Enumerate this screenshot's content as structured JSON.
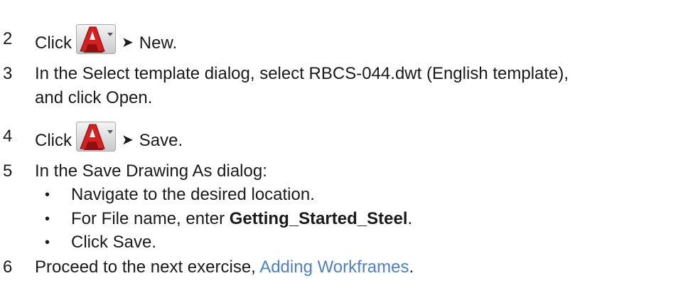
{
  "steps": [
    {
      "num": "2",
      "pre": "Click",
      "arrow": "➤",
      "post": "New."
    },
    {
      "num": "3",
      "line1": "In the Select template dialog, select RBCS-044.dwt (English template),",
      "line2": "and click Open."
    },
    {
      "num": "4",
      "pre": "Click",
      "arrow": "➤",
      "post": "Save."
    },
    {
      "num": "5",
      "text": "In the Save Drawing As dialog:"
    },
    {
      "num": "6",
      "pre": "Proceed to the next exercise, ",
      "link": "Adding Workframes",
      "post": "."
    }
  ],
  "bullets": [
    {
      "text": "Navigate to the desired location."
    },
    {
      "pre": "For File name, enter ",
      "bold": "Getting_Started_Steel",
      "post": "."
    },
    {
      "text": "Click Save."
    }
  ],
  "bullet_symbol": "•",
  "icons": {
    "app_button": "autocad-application-menu-icon"
  },
  "colors": {
    "link": "#4f81bd",
    "text": "#1a1a1a"
  }
}
